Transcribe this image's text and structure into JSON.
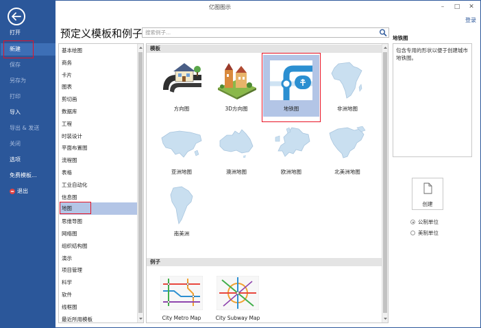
{
  "window": {
    "title": "亿图图示",
    "minimize": "–",
    "maximize": "□",
    "close": "✕",
    "login": "登录"
  },
  "nav": {
    "items": [
      {
        "label": "打开",
        "state": "normal"
      },
      {
        "label": "新建",
        "state": "active"
      },
      {
        "label": "保存",
        "state": "dim"
      },
      {
        "label": "另存为",
        "state": "dim"
      },
      {
        "label": "打印",
        "state": "dim"
      },
      {
        "label": "导入",
        "state": "normal"
      },
      {
        "label": "导出 & 发送",
        "state": "dim"
      },
      {
        "label": "关闭",
        "state": "dim"
      },
      {
        "label": "选项",
        "state": "normal"
      },
      {
        "label": "免费模板...",
        "state": "normal"
      },
      {
        "label": "退出",
        "state": "normal"
      }
    ]
  },
  "main": {
    "heading": "预定义模板和例子",
    "search": {
      "placeholder": "搜索例子..."
    },
    "categories": [
      "基本绘图",
      "商务",
      "卡片",
      "图表",
      "剪切画",
      "数据库",
      "工程",
      "时装设计",
      "平面布置图",
      "流程图",
      "表格",
      "工业自动化",
      "信息图",
      "地图",
      "思维导图",
      "网络图",
      "组织结构图",
      "演示",
      "项目管理",
      "科学",
      "软件",
      "线框图",
      "最近所用模板"
    ],
    "selected_category": "地图",
    "templates_header": "模板",
    "templates": [
      {
        "label": "方向图",
        "icon": "house-street-icon"
      },
      {
        "label": "3D方向图",
        "icon": "3d-buildings-icon"
      },
      {
        "label": "地铁图",
        "icon": "subway-map-icon",
        "selected": true
      },
      {
        "label": "非洲地图",
        "icon": "africa-map-icon"
      },
      {
        "label": "亚洲地图",
        "icon": "asia-map-icon"
      },
      {
        "label": "澳洲地图",
        "icon": "australia-map-icon"
      },
      {
        "label": "欧洲地图",
        "icon": "europe-map-icon"
      },
      {
        "label": "北美洲地图",
        "icon": "north-america-map-icon"
      },
      {
        "label": "南美洲",
        "icon": "south-america-map-icon"
      }
    ],
    "examples_header": "例子",
    "examples": [
      {
        "label": "City Metro Map"
      },
      {
        "label": "City Subway Map"
      }
    ]
  },
  "details": {
    "title": "地铁图",
    "description": "包含专用的形状以便于创建城市地铁图。",
    "create_label": "创建",
    "units": [
      {
        "label": "公制单位",
        "checked": true
      },
      {
        "label": "美制单位",
        "checked": false
      }
    ]
  },
  "colors": {
    "nav_bg": "#2b579a",
    "selection": "#b3c5e6",
    "highlight": "#e81123",
    "map_fill": "#c9dff0"
  }
}
